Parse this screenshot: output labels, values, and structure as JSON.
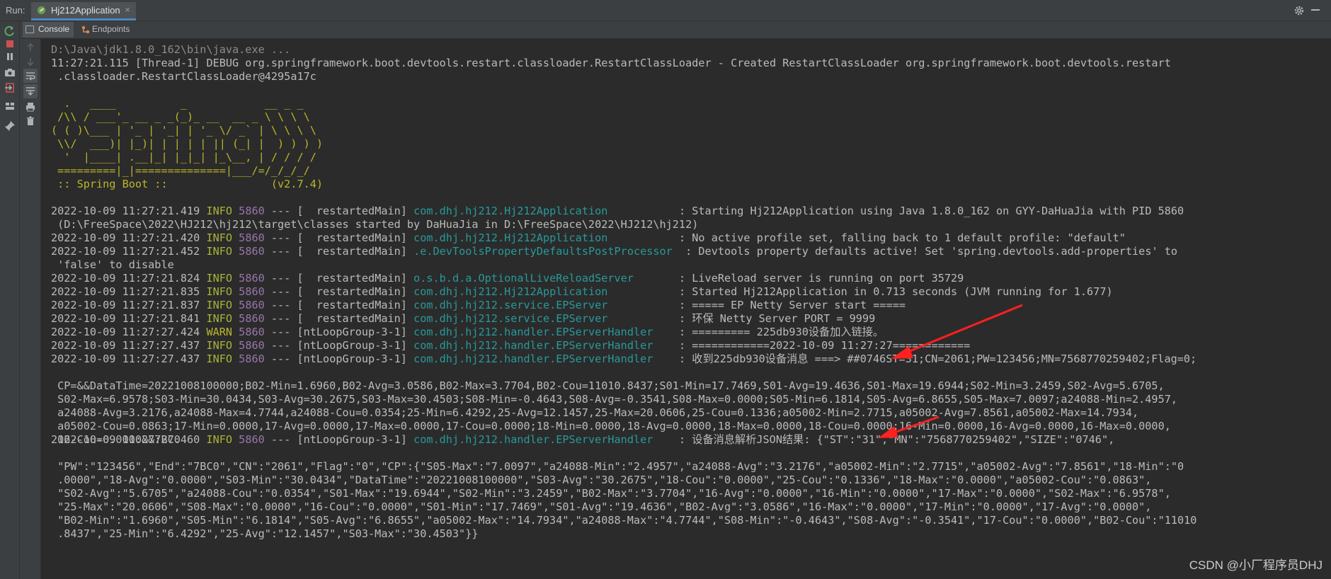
{
  "topbar": {
    "run_label": "Run:",
    "tab_title": "Hj212Application",
    "tab_close": "×"
  },
  "subtabs": {
    "console": "Console",
    "endpoints": "Endpoints"
  },
  "console": {
    "lines": [
      "D:\\Java\\jdk1.8.0_162\\bin\\java.exe ...",
      "11:27:21.115 [Thread-1] DEBUG org.springframework.boot.devtools.restart.classloader.RestartClassLoader - Created RestartClassLoader org.springframework.boot.devtools.restart",
      " .classloader.RestartClassLoader@4295a17c",
      "",
      "  .   ____          _            __ _ _",
      " /\\\\ / ___'_ __ _ _(_)_ __  __ _ \\ \\ \\ \\",
      "( ( )\\___ | '_ | '_| | '_ \\/ _` | \\ \\ \\ \\",
      " \\\\/  ___)| |_)| | | | | || (_| |  ) ) ) )",
      "  '  |____| .__|_| |_|_| |_\\__, | / / / /",
      " =========|_|==============|___/=/_/_/_/",
      " :: Spring Boot ::                (v2.7.4)",
      "",
      "",
      " (D:\\FreeSpace\\2022\\HJ212\\hj212\\target\\classes started by DaHuaJia in D:\\FreeSpace\\2022\\HJ212\\hj212)",
      "",
      "",
      " 'false' to disable",
      "",
      "",
      "",
      "",
      "",
      "",
      "",
      "",
      " CP=&&DataTime=20221008100000;B02-Min=1.6960,B02-Avg=3.0586,B02-Max=3.7704,B02-Cou=11010.8437;S01-Min=17.7469,S01-Avg=19.4636,S01-Max=19.6944;S02-Min=3.2459,S02-Avg=5.6705,",
      " S02-Max=6.9578;S03-Min=30.0434,S03-Avg=30.2675,S03-Max=30.4503;S08-Min=-0.4643,S08-Avg=-0.3541,S08-Max=0.0000;S05-Min=6.1814,S05-Avg=6.8655,S05-Max=7.0097;a24088-Min=2.4957,",
      " a24088-Avg=3.2176,a24088-Max=4.7744,a24088-Cou=0.0354;25-Min=6.4292,25-Avg=12.1457,25-Max=20.0606,25-Cou=0.1336;a05002-Min=2.7715,a05002-Avg=7.8561,a05002-Max=14.7934,",
      " a05002-Cou=0.0863;17-Min=0.0000,17-Avg=0.0000,17-Max=0.0000,17-Cou=0.0000;18-Min=0.0000,18-Avg=0.0000,18-Max=0.0000,18-Cou=0.0000;16-Min=0.0000,16-Avg=0.0000,16-Max=0.0000,",
      " 16-Cou=0.0000&&7BC0",
      "",
      " \"PW\":\"123456\",\"End\":\"7BC0\",\"CN\":\"2061\",\"Flag\":\"0\",\"CP\":{\"S05-Max\":\"7.0097\",\"a24088-Min\":\"2.4957\",\"a24088-Avg\":\"3.2176\",\"a05002-Min\":\"2.7715\",\"a05002-Avg\":\"7.8561\",\"18-Min\":\"0",
      " .0000\",\"18-Avg\":\"0.0000\",\"S03-Min\":\"30.0434\",\"DataTime\":\"20221008100000\",\"S03-Avg\":\"30.2675\",\"18-Cou\":\"0.0000\",\"25-Cou\":\"0.1336\",\"18-Max\":\"0.0000\",\"a05002-Cou\":\"0.0863\",",
      " \"S02-Avg\":\"5.6705\",\"a24088-Cou\":\"0.0354\",\"S01-Max\":\"19.6944\",\"S02-Min\":\"3.2459\",\"B02-Max\":\"3.7704\",\"16-Avg\":\"0.0000\",\"16-Min\":\"0.0000\",\"17-Max\":\"0.0000\",\"S02-Max\":\"6.9578\",",
      " \"25-Max\":\"20.0606\",\"S08-Max\":\"0.0000\",\"16-Cou\":\"0.0000\",\"S01-Min\":\"17.7469\",\"S01-Avg\":\"19.4636\",\"B02-Avg\":\"3.0586\",\"16-Max\":\"0.0000\",\"17-Min\":\"0.0000\",\"17-Avg\":\"0.0000\",",
      " \"B02-Min\":\"1.6960\",\"S05-Min\":\"6.1814\",\"S05-Avg\":\"6.8655\",\"a05002-Max\":\"14.7934\",\"a24088-Max\":\"4.7744\",\"S08-Min\":\"-0.4643\",\"S08-Avg\":\"-0.3541\",\"17-Cou\":\"0.0000\",\"B02-Cou\":\"11010",
      " .8437\",\"25-Min\":\"6.4292\",\"25-Avg\":\"12.1457\",\"S03-Max\":\"30.4503\"}}"
    ],
    "log_entries": [
      {
        "row": 12,
        "ts": "2022-10-09 11:27:21.419",
        "level": "INFO",
        "pid": "5860",
        "thread": "  restartedMain",
        "logger": "com.dhj.hj212.Hj212Application          ",
        "msg": "Starting Hj212Application using Java 1.8.0_162 on GYY-DaHuaJia with PID 5860"
      },
      {
        "row": 14,
        "ts": "2022-10-09 11:27:21.420",
        "level": "INFO",
        "pid": "5860",
        "thread": "  restartedMain",
        "logger": "com.dhj.hj212.Hj212Application          ",
        "msg": "No active profile set, falling back to 1 default profile: \"default\""
      },
      {
        "row": 15,
        "ts": "2022-10-09 11:27:21.452",
        "level": "INFO",
        "pid": "5860",
        "thread": "  restartedMain",
        "logger": ".e.DevToolsPropertyDefaultsPostProcessor ",
        "msg": "Devtools property defaults active! Set 'spring.devtools.add-properties' to"
      },
      {
        "row": 17,
        "ts": "2022-10-09 11:27:21.824",
        "level": "INFO",
        "pid": "5860",
        "thread": "  restartedMain",
        "logger": "o.s.b.d.a.OptionalLiveReloadServer      ",
        "msg": "LiveReload server is running on port 35729"
      },
      {
        "row": 18,
        "ts": "2022-10-09 11:27:21.835",
        "level": "INFO",
        "pid": "5860",
        "thread": "  restartedMain",
        "logger": "com.dhj.hj212.Hj212Application          ",
        "msg": "Started Hj212Application in 0.713 seconds (JVM running for 1.677)"
      },
      {
        "row": 19,
        "ts": "2022-10-09 11:27:21.837",
        "level": "INFO",
        "pid": "5860",
        "thread": "  restartedMain",
        "logger": "com.dhj.hj212.service.EPServer          ",
        "msg": "===== EP Netty Server start ====="
      },
      {
        "row": 20,
        "ts": "2022-10-09 11:27:21.841",
        "level": "INFO",
        "pid": "5860",
        "thread": "  restartedMain",
        "logger": "com.dhj.hj212.service.EPServer          ",
        "msg": "环保 Netty Server PORT = 9999"
      },
      {
        "row": 21,
        "ts": "2022-10-09 11:27:27.424",
        "level": "WARN",
        "pid": "5860",
        "thread": "ntLoopGroup-3-1",
        "logger": "com.dhj.hj212.handler.EPServerHandler   ",
        "msg": "========= 225db930设备加入链接。"
      },
      {
        "row": 22,
        "ts": "2022-10-09 11:27:27.437",
        "level": "INFO",
        "pid": "5860",
        "thread": "ntLoopGroup-3-1",
        "logger": "com.dhj.hj212.handler.EPServerHandler   ",
        "msg": "============2022-10-09 11:27:27============"
      },
      {
        "row": 23,
        "ts": "2022-10-09 11:27:27.437",
        "level": "INFO",
        "pid": "5860",
        "thread": "ntLoopGroup-3-1",
        "logger": "com.dhj.hj212.handler.EPServerHandler   ",
        "msg": "收到225db930设备消息 ===> ##0746ST=31;CN=2061;PW=123456;MN=7568770259402;Flag=0;"
      },
      {
        "row": 29,
        "ts": "2022-10-09 11:27:27.460",
        "level": "INFO",
        "pid": "5860",
        "thread": "ntLoopGroup-3-1",
        "logger": "com.dhj.hj212.handler.EPServerHandler   ",
        "msg": "设备消息解析JSON结果: {\"ST\":\"31\",\"MN\":\"7568770259402\",\"SIZE\":\"0746\","
      }
    ]
  },
  "watermark": "CSDN @小厂程序员DHJ",
  "colors": {
    "background": "#2b2b2b",
    "info": "#a9b337",
    "warn": "#bbb529",
    "pid": "#9876aa",
    "logger": "#299999",
    "annotation_arrow": "#ff2020"
  }
}
